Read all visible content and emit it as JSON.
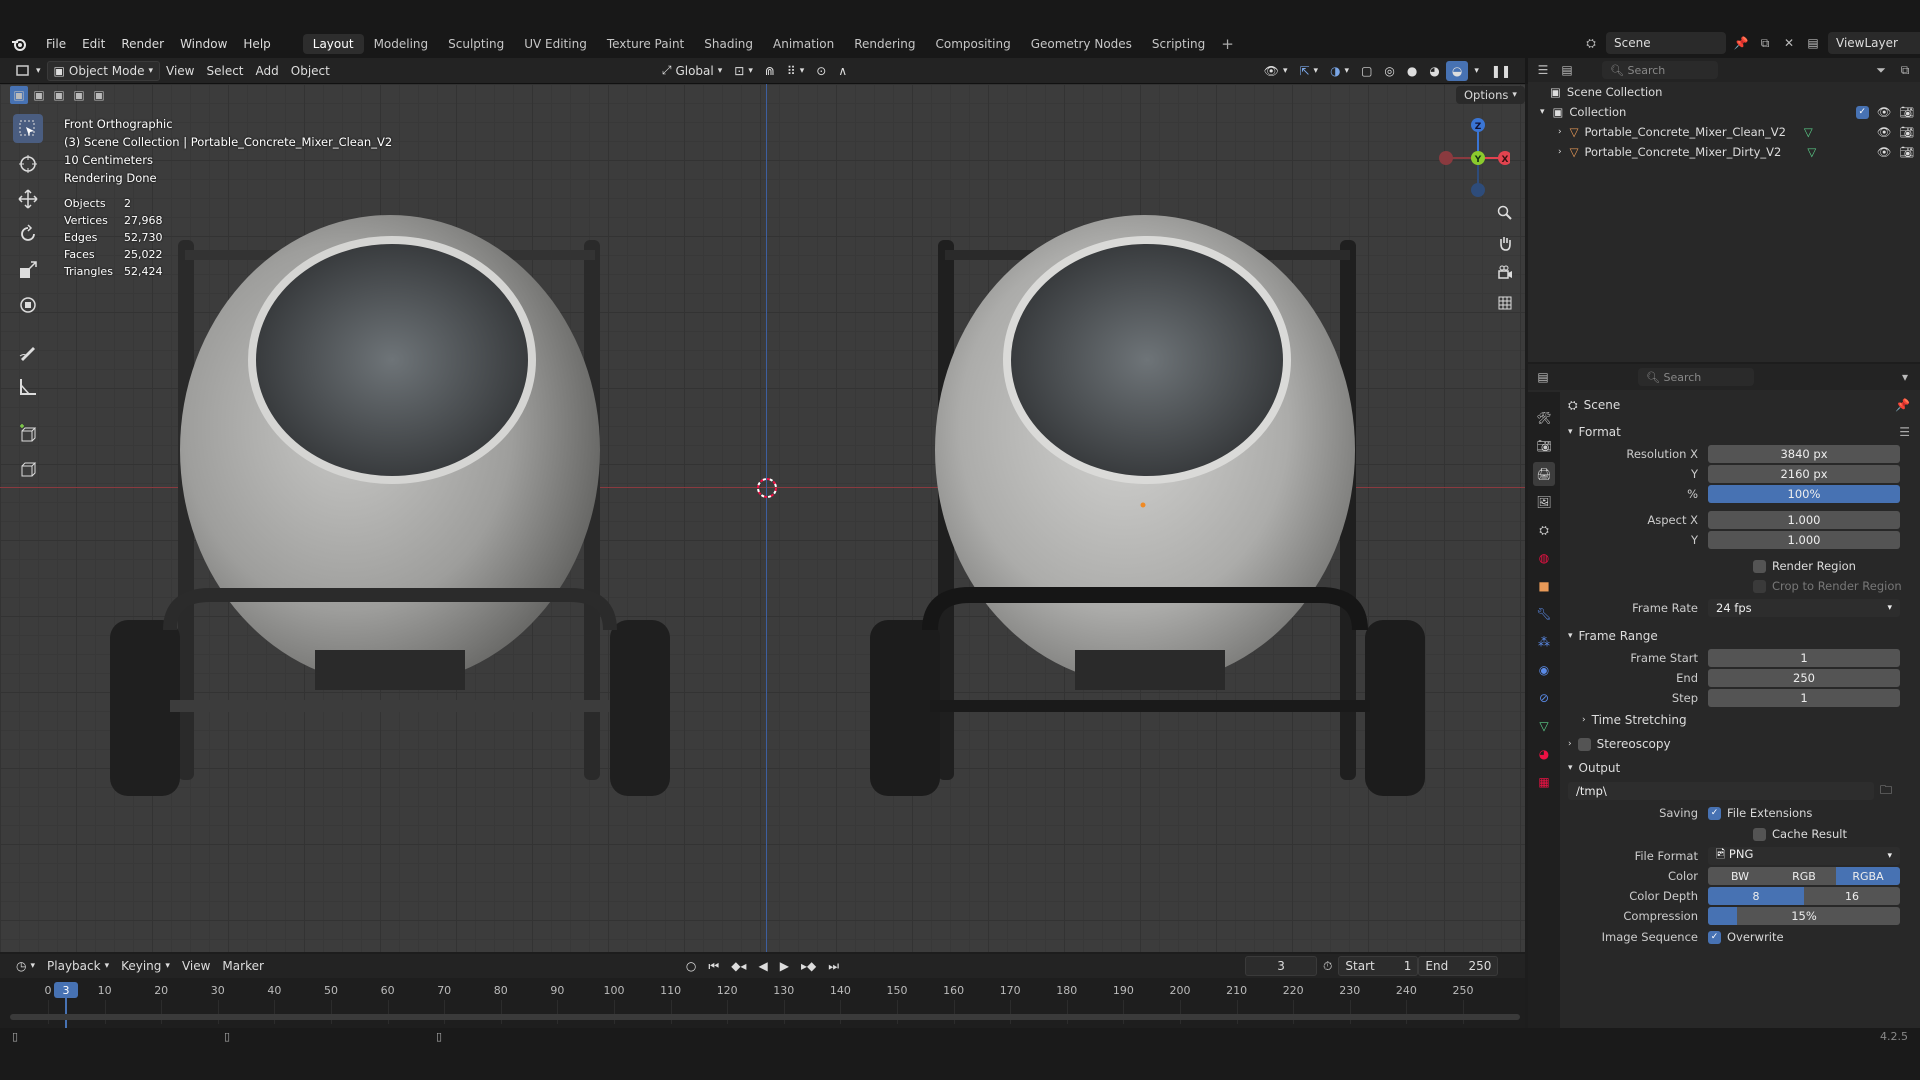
{
  "menubar": {
    "items": [
      "File",
      "Edit",
      "Render",
      "Window",
      "Help"
    ]
  },
  "workspaces": [
    "Layout",
    "Modeling",
    "Sculpting",
    "UV Editing",
    "Texture Paint",
    "Shading",
    "Animation",
    "Rendering",
    "Compositing",
    "Geometry Nodes",
    "Scripting"
  ],
  "active_workspace": "Layout",
  "scene_name": "Scene",
  "view_layer": "ViewLayer",
  "viewport_header": {
    "mode": "Object Mode",
    "menus": [
      "View",
      "Select",
      "Add",
      "Object"
    ],
    "orientation": "Global",
    "options": "Options"
  },
  "viewport_overlay": {
    "view_name": "Front Orthographic",
    "collection_line": "(3) Scene Collection | Portable_Concrete_Mixer_Clean_V2",
    "scale": "10 Centimeters",
    "status": "Rendering Done",
    "stats": [
      {
        "label": "Objects",
        "value": "2"
      },
      {
        "label": "Vertices",
        "value": "27,968"
      },
      {
        "label": "Edges",
        "value": "52,730"
      },
      {
        "label": "Faces",
        "value": "25,022"
      },
      {
        "label": "Triangles",
        "value": "52,424"
      }
    ]
  },
  "gizmo": {
    "z": "Z",
    "y": "Y",
    "x": "X"
  },
  "timeline": {
    "menus": [
      "Playback",
      "Keying",
      "View",
      "Marker"
    ],
    "current_frame": "3",
    "start_label": "Start",
    "start": "1",
    "end_label": "End",
    "end": "250",
    "ticks": [
      "0",
      "10",
      "20",
      "30",
      "40",
      "50",
      "60",
      "70",
      "80",
      "90",
      "100",
      "110",
      "120",
      "130",
      "140",
      "150",
      "160",
      "170",
      "180",
      "190",
      "200",
      "210",
      "220",
      "230",
      "240",
      "250"
    ]
  },
  "outliner": {
    "search_placeholder": "Search",
    "root": "Scene Collection",
    "collection": "Collection",
    "objects": [
      "Portable_Concrete_Mixer_Clean_V2",
      "Portable_Concrete_Mixer_Dirty_V2"
    ]
  },
  "properties": {
    "search_placeholder": "Search",
    "context": "Scene",
    "format": {
      "title": "Format",
      "resolution_x_label": "Resolution X",
      "resolution_x": "3840 px",
      "y_label": "Y",
      "resolution_y": "2160 px",
      "percent_label": "%",
      "percent": "100%",
      "aspect_x_label": "Aspect X",
      "aspect_x": "1.000",
      "aspect_y_label": "Y",
      "aspect_y": "1.000",
      "render_region": "Render Region",
      "crop": "Crop to Render Region",
      "frame_rate_label": "Frame Rate",
      "frame_rate": "24 fps"
    },
    "frame_range": {
      "title": "Frame Range",
      "start_label": "Frame Start",
      "start": "1",
      "end_label": "End",
      "end": "250",
      "step_label": "Step",
      "step": "1",
      "time_stretching": "Time Stretching"
    },
    "stereoscopy": "Stereoscopy",
    "output": {
      "title": "Output",
      "path": "/tmp\\",
      "saving_label": "Saving",
      "file_extensions": "File Extensions",
      "cache_result": "Cache Result",
      "file_format_label": "File Format",
      "file_format": "PNG",
      "color_label": "Color",
      "color_options": [
        "BW",
        "RGB",
        "RGBA"
      ],
      "color_depth_label": "Color Depth",
      "color_depth_options": [
        "8",
        "16"
      ],
      "compression_label": "Compression",
      "compression": "15%",
      "compression_value": 0.15,
      "image_sequence_label": "Image Sequence",
      "overwrite": "Overwrite"
    }
  },
  "version": "4.2.5",
  "colors": {
    "accent": "#4772b3",
    "x_axis": "#e2434f",
    "y_axis": "#8bcb2d",
    "z_axis": "#3a75d4"
  }
}
